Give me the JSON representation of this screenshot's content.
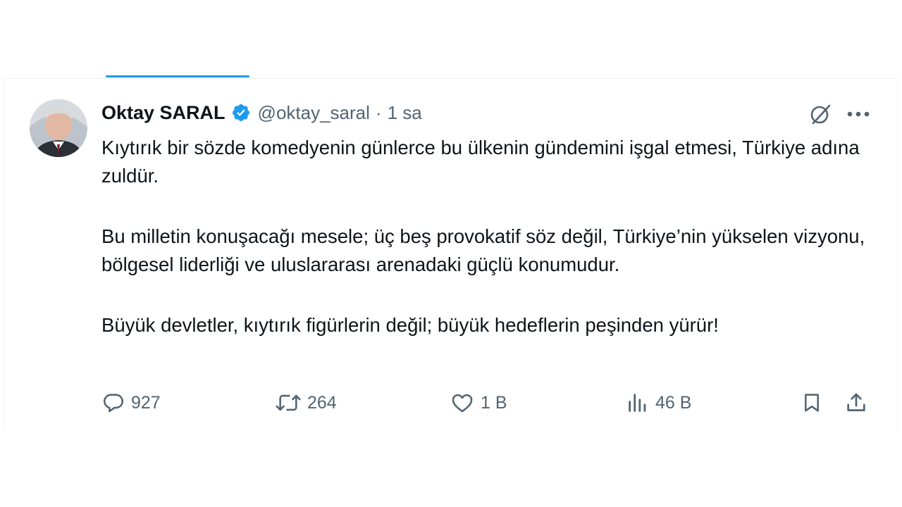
{
  "tweet": {
    "author_name": "Oktay SARAL",
    "handle": "@oktay_saral",
    "separator": "·",
    "time": "1 sa",
    "paragraphs": [
      "Kıytırık bir sözde komedyenin günlerce bu ülkenin gündemini işgal etmesi, Türkiye adına zuldür.",
      "Bu milletin konuşacağı mesele; üç beş provokatif söz değil, Türkiye’nin yükselen vizyonu, bölgesel liderliği ve uluslararası arenadaki güçlü konumudur.",
      "Büyük devletler, kıytırık figürlerin değil; büyük hedeflerin peşinden yürür!"
    ],
    "replies": "927",
    "reposts": "264",
    "likes": "1 B",
    "views": "46 B"
  },
  "icons": {
    "verified": "verified-badge-icon",
    "grok": "grok-icon",
    "more": "more-icon",
    "reply": "reply-icon",
    "repost": "repost-icon",
    "like": "like-icon",
    "views": "views-icon",
    "bookmark": "bookmark-icon",
    "share": "share-icon"
  },
  "colors": {
    "accent": "#1d9bf0",
    "text": "#0f1419",
    "secondary_text": "#536471"
  }
}
